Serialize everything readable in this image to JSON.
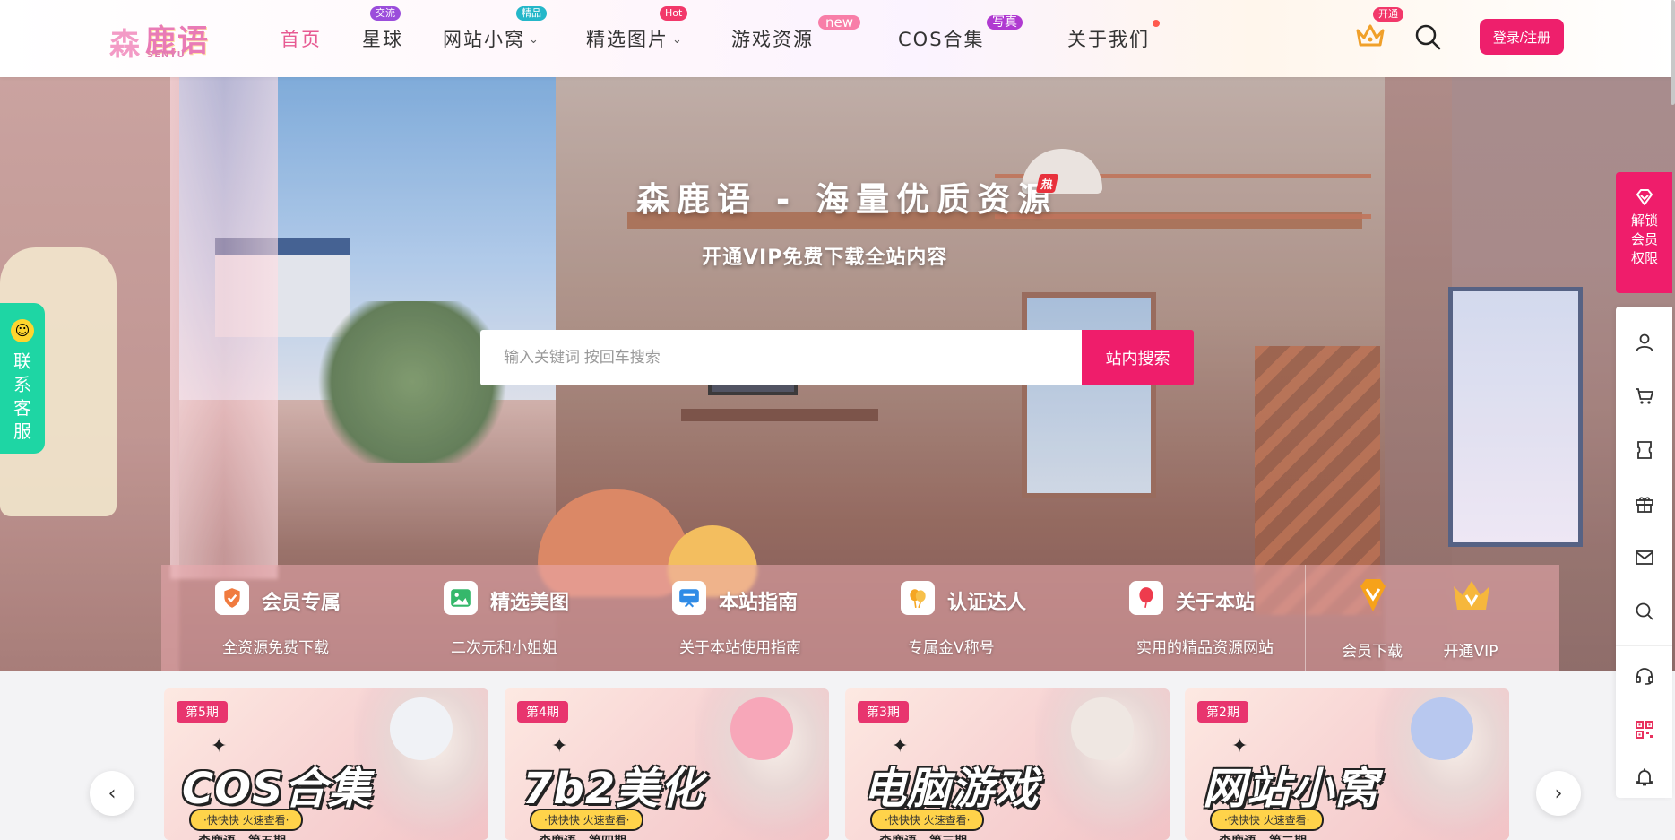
{
  "logo": {
    "text": "鹿语",
    "icon_char": "森",
    "sub": "SENYU"
  },
  "nav": {
    "items": [
      {
        "label": "首页",
        "active": true
      },
      {
        "label": "星球",
        "badge": "交流",
        "badge_color": "#9b4ddb"
      },
      {
        "label": "网站小窝",
        "badge": "精品",
        "badge_color": "#25b7c9",
        "dropdown": true
      },
      {
        "label": "精选图片",
        "badge": "Hot",
        "badge_color": "#f2386a",
        "dropdown": true
      },
      {
        "label": "游戏资源",
        "badge": "new",
        "badge_color": "#f87ea8"
      },
      {
        "label": "COS合集",
        "badge": "写真",
        "badge_color": "#b03ad1"
      },
      {
        "label": "关于我们",
        "dot": true
      }
    ],
    "chevron": "⌄"
  },
  "header_actions": {
    "crown_badge": "开通",
    "login_label": "登录/注册"
  },
  "hero": {
    "title": "森鹿语 - 海量优质资源",
    "hot_tag": "热",
    "subtitle": "开通VIP免费下载全站内容",
    "search_placeholder": "输入关键词 按回车搜索",
    "search_button": "站内搜索"
  },
  "features": [
    {
      "title": "会员专属",
      "desc": "全资源免费下载",
      "icon": "shield-check-icon",
      "icon_color": "#f07b3f"
    },
    {
      "title": "精选美图",
      "desc": "二次元和小姐姐",
      "icon": "image-icon",
      "icon_color": "#35b86b"
    },
    {
      "title": "本站指南",
      "desc": "关于本站使用指南",
      "icon": "presentation-icon",
      "icon_color": "#2f8be6"
    },
    {
      "title": "认证达人",
      "desc": "专属金V称号",
      "icon": "balloons-icon",
      "icon_color": "#f5a623"
    },
    {
      "title": "关于本站",
      "desc": "实用的精品资源网站",
      "icon": "balloon-icon",
      "icon_color": "#ee3b4d"
    }
  ],
  "vip_actions": [
    {
      "label": "会员下载",
      "icon": "diamond-icon",
      "color": "#f6a21a"
    },
    {
      "label": "开通VIP",
      "icon": "crown-icon",
      "color": "#f6a21a"
    }
  ],
  "contact_float": {
    "label": "联系客服",
    "icon": "smile-icon"
  },
  "unlock_panel": {
    "label": "解锁会员权限",
    "icon": "diamond-outline-icon"
  },
  "side_tools": [
    {
      "name": "user-icon"
    },
    {
      "name": "cart-icon"
    },
    {
      "name": "ticket-icon"
    },
    {
      "name": "gift-icon"
    },
    {
      "name": "mail-icon"
    },
    {
      "name": "search-icon"
    },
    {
      "name": "headset-icon"
    },
    {
      "name": "qrcode-icon"
    },
    {
      "name": "bell-icon"
    }
  ],
  "carousel": {
    "prev": "‹",
    "next": "›",
    "cards": [
      {
        "issue": "第5期",
        "title": "COS合集",
        "pill": "·快快快 火速查看·",
        "footer": "森鹿语—第五期",
        "hair": "#f0f2f6",
        "accent": "#39a6e8"
      },
      {
        "issue": "第4期",
        "title": "7b2美化",
        "pill": "·快快快 火速查看·",
        "footer": "森鹿语—第四期",
        "hair": "#f7a7b9",
        "accent": "#5b3b4e"
      },
      {
        "issue": "第3期",
        "title": "电脑游戏",
        "pill": "·快快快 火速查看·",
        "footer": "森鹿语—第三期",
        "hair": "#efe7e2",
        "accent": "#c6a79a"
      },
      {
        "issue": "第2期",
        "title": "网站小窝",
        "pill": "·快快快 火速查看·",
        "footer": "森鹿语—第二期",
        "hair": "#b8c8ef",
        "accent": "#7f95d6"
      }
    ]
  }
}
